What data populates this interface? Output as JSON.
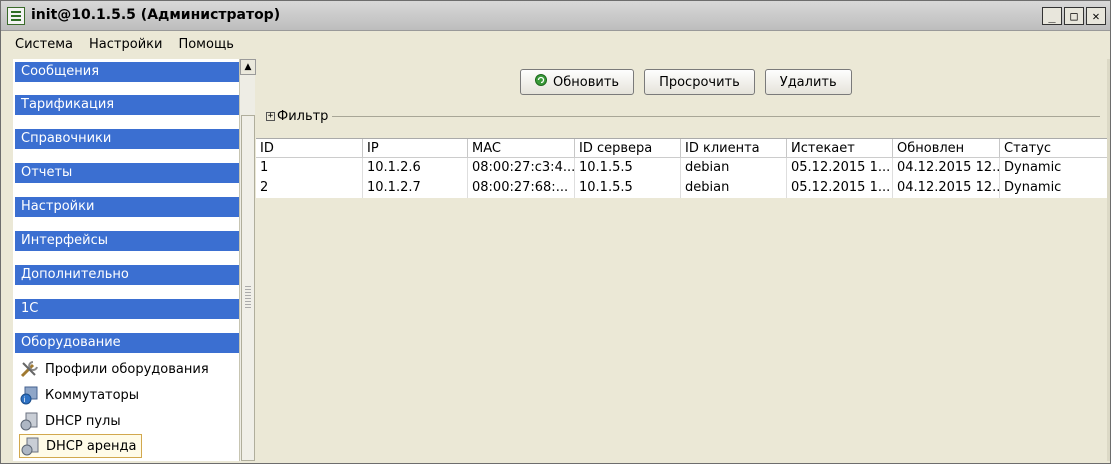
{
  "window": {
    "title": "init@10.1.5.5 (Администратор)"
  },
  "menu": [
    "Система",
    "Настройки",
    "Помощь"
  ],
  "sidebar": {
    "sections": [
      "Сообщения",
      "Тарификация",
      "Справочники",
      "Отчеты",
      "Настройки",
      "Интерфейсы",
      "Дополнительно",
      "1С",
      "Оборудование"
    ],
    "items": [
      {
        "label": "Профили оборудования",
        "icon": "tools-icon"
      },
      {
        "label": "Коммутаторы",
        "icon": "switch-icon"
      },
      {
        "label": "DHCP пулы",
        "icon": "dhcp-pool-icon"
      },
      {
        "label": "DHCP аренда",
        "icon": "dhcp-lease-icon",
        "selected": true
      }
    ]
  },
  "toolbar": {
    "refresh_label": "Обновить",
    "expire_label": "Просрочить",
    "delete_label": "Удалить"
  },
  "filter": {
    "label": "Фильтр"
  },
  "table": {
    "columns": [
      "ID",
      "IP",
      "MAC",
      "ID сервера",
      "ID клиента",
      "Истекает",
      "Обновлен",
      "Статус"
    ],
    "rows": [
      [
        "1",
        "10.1.2.6",
        "08:00:27:c3:4...",
        "10.1.5.5",
        "debian",
        "05.12.2015 1...",
        "04.12.2015 12...",
        "Dynamic"
      ],
      [
        "2",
        "10.1.2.7",
        "08:00:27:68:...",
        "10.1.5.5",
        "debian",
        "05.12.2015 1...",
        "04.12.2015 12...",
        "Dynamic"
      ]
    ]
  },
  "colors": {
    "section_bg": "#3b6fd1",
    "window_bg": "#ebe8d6"
  }
}
